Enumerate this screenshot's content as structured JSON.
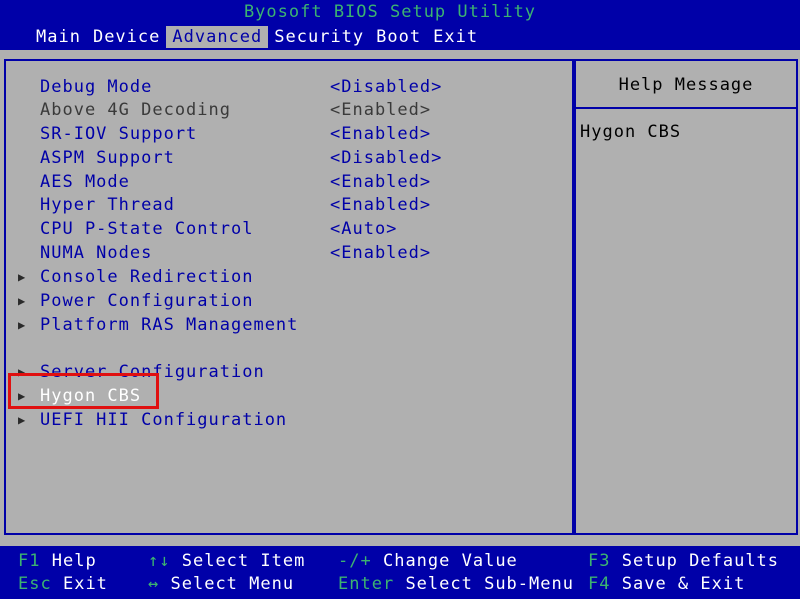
{
  "title": "Byosoft BIOS Setup Utility",
  "menu": [
    "Main",
    "Device",
    "Advanced",
    "Security",
    "Boot",
    "Exit"
  ],
  "active_menu": "Advanced",
  "items": [
    {
      "label": "Debug Mode",
      "value": "<Disabled>"
    },
    {
      "label": "Above 4G Decoding",
      "value": "<Enabled>"
    },
    {
      "label": "SR-IOV Support",
      "value": "<Enabled>"
    },
    {
      "label": "ASPM Support",
      "value": "<Disabled>"
    },
    {
      "label": "AES Mode",
      "value": "<Enabled>"
    },
    {
      "label": "Hyper Thread",
      "value": "<Enabled>"
    },
    {
      "label": "CPU P-State Control",
      "value": "<Auto>"
    },
    {
      "label": "NUMA Nodes",
      "value": "<Enabled>"
    },
    {
      "label": "Console Redirection"
    },
    {
      "label": "Power Configuration"
    },
    {
      "label": "Platform RAS Management"
    },
    {
      "label": "Server Configuration"
    },
    {
      "label": "Hygon CBS"
    },
    {
      "label": "UEFI HII Configuration"
    }
  ],
  "help": {
    "title": "Help Message",
    "text": "Hygon CBS"
  },
  "footer": [
    {
      "key": "F1",
      "desc": "Help"
    },
    {
      "key": "Esc",
      "desc": "Exit"
    },
    {
      "key": "↑↓",
      "desc": "Select Item"
    },
    {
      "key": "↔",
      "desc": "Select Menu"
    },
    {
      "key": "-/+",
      "desc": "Change Value"
    },
    {
      "key": "Enter",
      "desc": "Select Sub-Menu"
    },
    {
      "key": "F3",
      "desc": "Setup Defaults"
    },
    {
      "key": "F4",
      "desc": "Save & Exit"
    }
  ],
  "colors": {
    "header_bg": "#0000a8",
    "body_bg": "#b0b0b0",
    "item_text": "#0000a8",
    "title_text": "#3cb371",
    "selected_text": "#ffffff",
    "highlight_box": "#e01010"
  }
}
